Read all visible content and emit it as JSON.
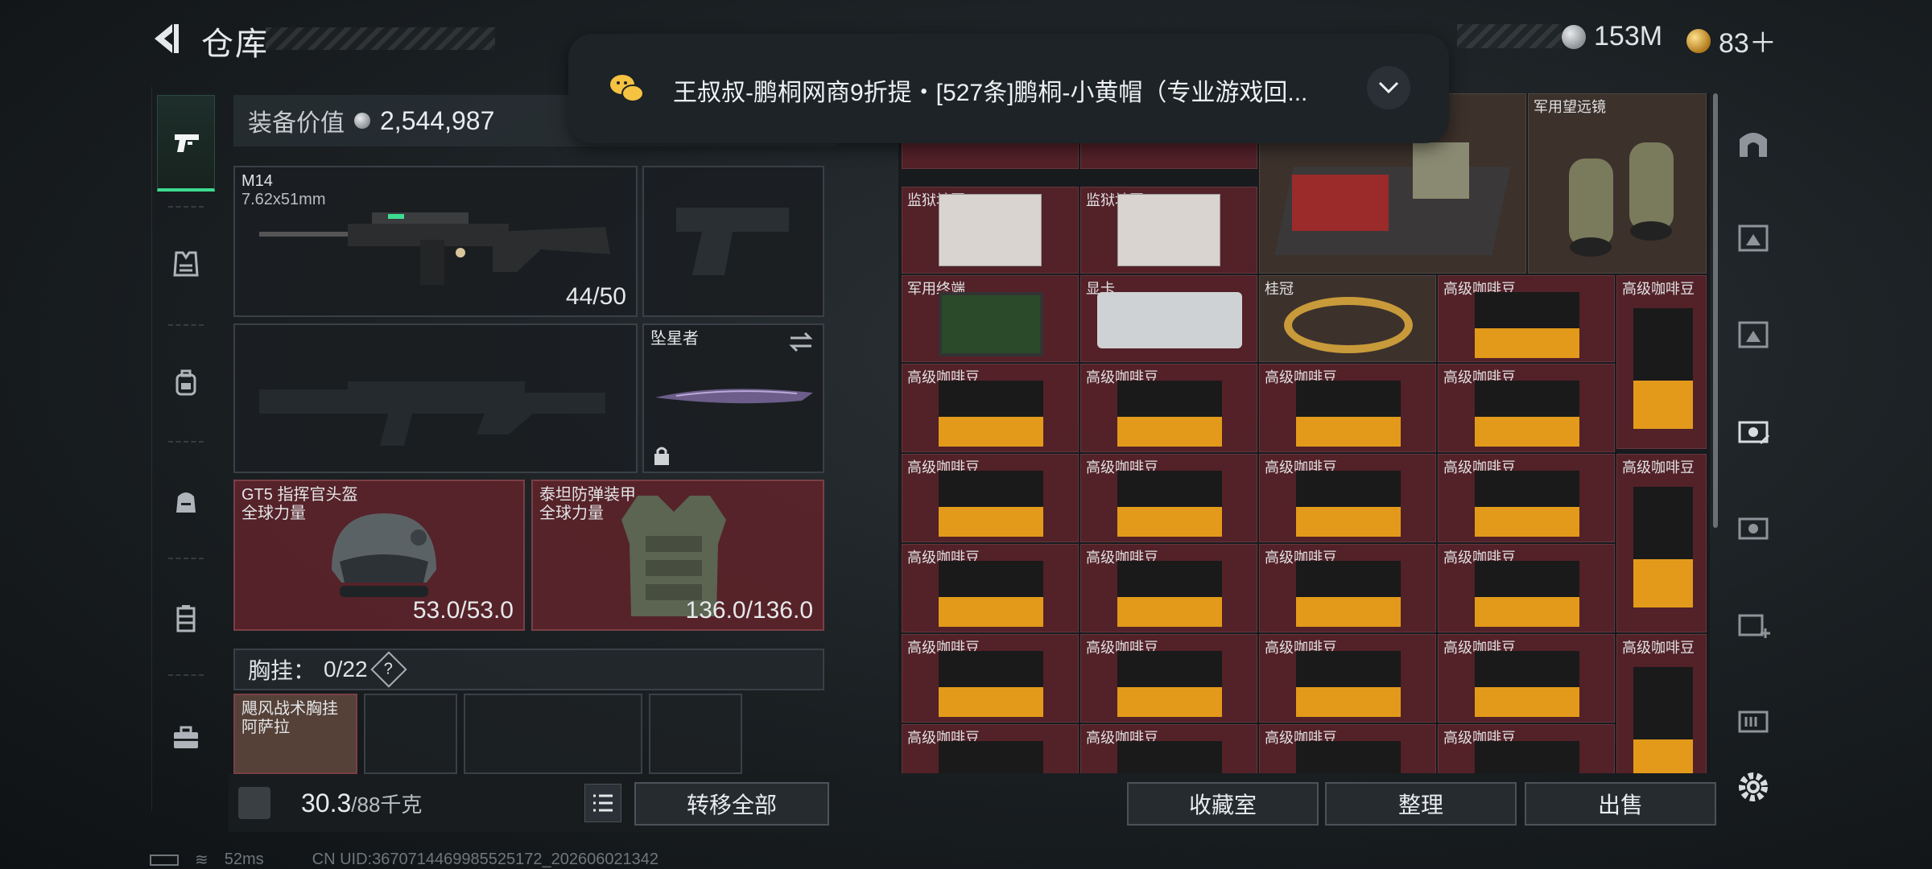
{
  "header": {
    "title": "仓库"
  },
  "currency": {
    "silver": "153M",
    "gold": "83＋"
  },
  "equipment": {
    "value_label": "装备价值",
    "value": "2,544,987",
    "primary_weapon": {
      "name": "M14",
      "ammo_type": "7.62x51mm",
      "ammo": "44/50"
    },
    "melee": {
      "name": "坠星者"
    },
    "helmet": {
      "name": "GT5 指挥官头盔",
      "brand": "全球力量",
      "durability": "53.0/53.0"
    },
    "armor": {
      "name": "泰坦防弹装甲",
      "brand": "全球力量",
      "durability": "136.0/136.0"
    },
    "chest_rig": {
      "label": "胸挂：",
      "capacity": "0/22",
      "help": "?"
    },
    "chest_item": {
      "name": "飓风战术胸挂",
      "sub": "阿萨拉"
    }
  },
  "weight": {
    "current": "30.3",
    "max": "/88千克"
  },
  "buttons": {
    "transfer_all": "转移全部",
    "collection": "收藏室",
    "organize": "整理",
    "sell": "出售"
  },
  "notification": {
    "text": "王叔叔-鹏桐网商9折提・[527条]鹏桐-小黄帽（专业游戏回..."
  },
  "storage": {
    "items": [
      {
        "label": "监狱地图",
        "type": "map"
      },
      {
        "label": "监狱地图",
        "type": "map"
      },
      {
        "label": "",
        "type": "big-case"
      },
      {
        "label": "军用望远镜",
        "type": "binoculars"
      },
      {
        "label": "军用终端",
        "type": "tablet"
      },
      {
        "label": "显卡",
        "type": "gpu"
      },
      {
        "label": "桂冠",
        "type": "crown"
      },
      {
        "label": "高级咖啡豆",
        "type": "coffee"
      },
      {
        "label": "高级咖啡豆",
        "type": "coffee-tall"
      }
    ],
    "coffee_label": "高级咖啡豆"
  },
  "status": {
    "ping": "52ms",
    "uid": "CN UID:3670714469985525172_202606021342"
  }
}
